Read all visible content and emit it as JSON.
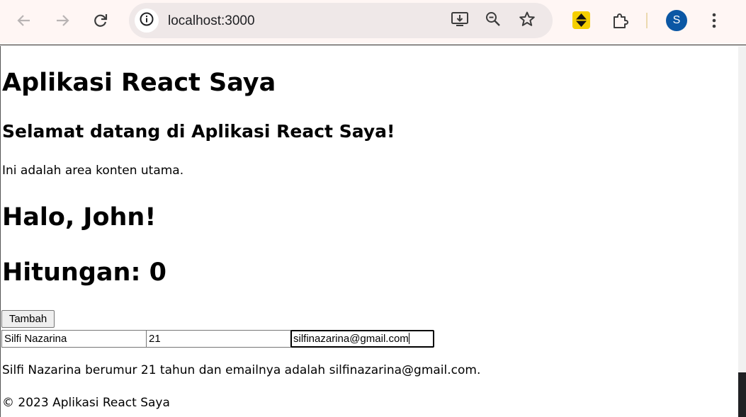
{
  "browser": {
    "url": "localhost:3000",
    "profile_initial": "S",
    "icons": {
      "back": "arrow-left-icon",
      "forward": "arrow-right-icon",
      "reload": "reload-icon",
      "site_info": "info-icon",
      "install": "install-app-icon",
      "zoom": "zoom-out-icon",
      "bookmark": "star-icon",
      "extension": "extension-sort-icon",
      "extensions_menu": "puzzle-icon",
      "menu": "kebab-menu-icon"
    },
    "colors": {
      "toolbar_bg": "#fff6f4",
      "avatar_bg": "#0b57a4",
      "extension_bg": "#f5cf00"
    }
  },
  "app": {
    "title": "Aplikasi React Saya",
    "welcome": "Selamat datang di Aplikasi React Saya!",
    "content_text": "Ini adalah area konten utama.",
    "greeting": "Halo, John!",
    "counter_text": "Hitungan: 0",
    "add_button": "Tambah",
    "form": {
      "name_value": "Silfi Nazarina",
      "age_value": "21",
      "email_value": "silfinazarina@gmail.com"
    },
    "summary": "Silfi Nazarina berumur 21 tahun dan emailnya adalah silfinazarina@gmail.com.",
    "footer": "© 2023 Aplikasi React Saya"
  }
}
